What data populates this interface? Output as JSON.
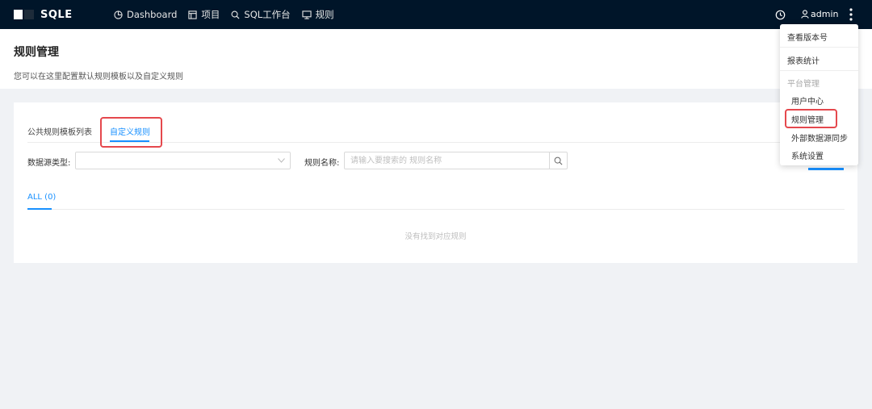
{
  "app": {
    "name": "SQLE"
  },
  "nav": {
    "items": [
      {
        "label": "Dashboard",
        "icon": "dashboard-icon"
      },
      {
        "label": "项目",
        "icon": "project-icon"
      },
      {
        "label": "SQL工作台",
        "icon": "search-icon"
      },
      {
        "label": "规则",
        "icon": "monitor-icon"
      }
    ]
  },
  "user": {
    "name": "admin"
  },
  "page": {
    "title": "规则管理",
    "description": "您可以在这里配置默认规则模板以及自定义规则"
  },
  "tabs": [
    {
      "label": "公共规则模板列表",
      "active": false
    },
    {
      "label": "自定义规则",
      "active": true
    }
  ],
  "filters": {
    "db_type_label": "数据源类型:",
    "db_type_value": "",
    "rule_name_label": "规则名称:",
    "rule_name_placeholder": "请输入要搜索的 规则名称"
  },
  "list": {
    "tab_label": "ALL (0)",
    "empty_text": "没有找到对应规则"
  },
  "dropdown": {
    "items": [
      {
        "label": "查看版本号"
      },
      {
        "label": "报表统计"
      }
    ],
    "group_label": "平台管理",
    "group_items": [
      {
        "label": "用户中心"
      },
      {
        "label": "规则管理"
      },
      {
        "label": "外部数据源同步"
      },
      {
        "label": "系统设置"
      }
    ]
  },
  "colors": {
    "topbar": "#001529",
    "accent": "#1890ff",
    "highlight": "#e5484d"
  }
}
